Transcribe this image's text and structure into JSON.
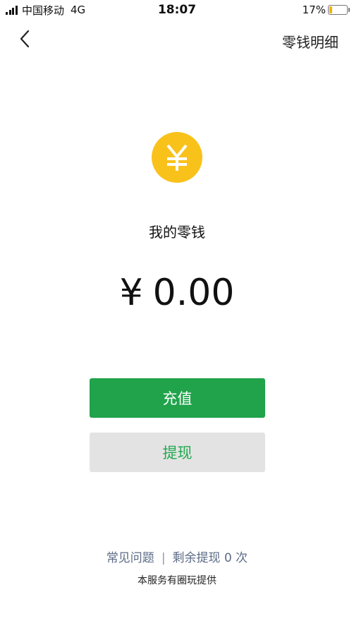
{
  "status_bar": {
    "carrier": "中国移动",
    "network": "4G",
    "time": "18:07",
    "battery_percent": "17%",
    "battery_level": 0.17,
    "battery_color": "#f0b400"
  },
  "nav": {
    "back_icon": "chevron-left-icon",
    "action_label": "零钱明细"
  },
  "wallet": {
    "icon": "yen-coin-icon",
    "icon_color": "#f9c21b",
    "label": "我的零钱",
    "currency": "¥",
    "balance": "0.00"
  },
  "actions": {
    "recharge_label": "充值",
    "recharge_color": "#20a34b",
    "withdraw_label": "提现",
    "withdraw_text_color": "#22a94f"
  },
  "footer": {
    "faq_label": "常见问题",
    "separator": "|",
    "withdraw_remaining": "剩余提现 0 次",
    "provider": "本服务有圈玩提供"
  }
}
